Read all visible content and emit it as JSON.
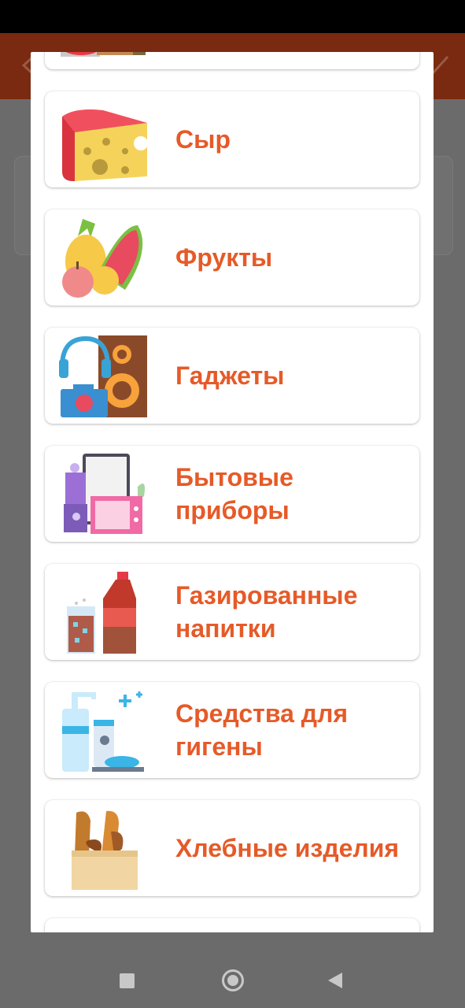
{
  "categories": [
    {
      "label": "Сыр",
      "icon": "cheese-icon"
    },
    {
      "label": "Фрукты",
      "icon": "fruits-icon"
    },
    {
      "label": "Гаджеты",
      "icon": "gadgets-icon"
    },
    {
      "label": "Бытовые\nприборы",
      "icon": "appliances-icon"
    },
    {
      "label": "Газированные\nнапитки",
      "icon": "soda-icon"
    },
    {
      "label": "Средства для\nгигены",
      "icon": "hygiene-icon"
    },
    {
      "label": "Хлебные изделия",
      "icon": "bread-icon"
    }
  ],
  "colors": {
    "accent": "#e65a28",
    "app_bar": "#7a2a10",
    "scrim": "#6b6b6b"
  }
}
